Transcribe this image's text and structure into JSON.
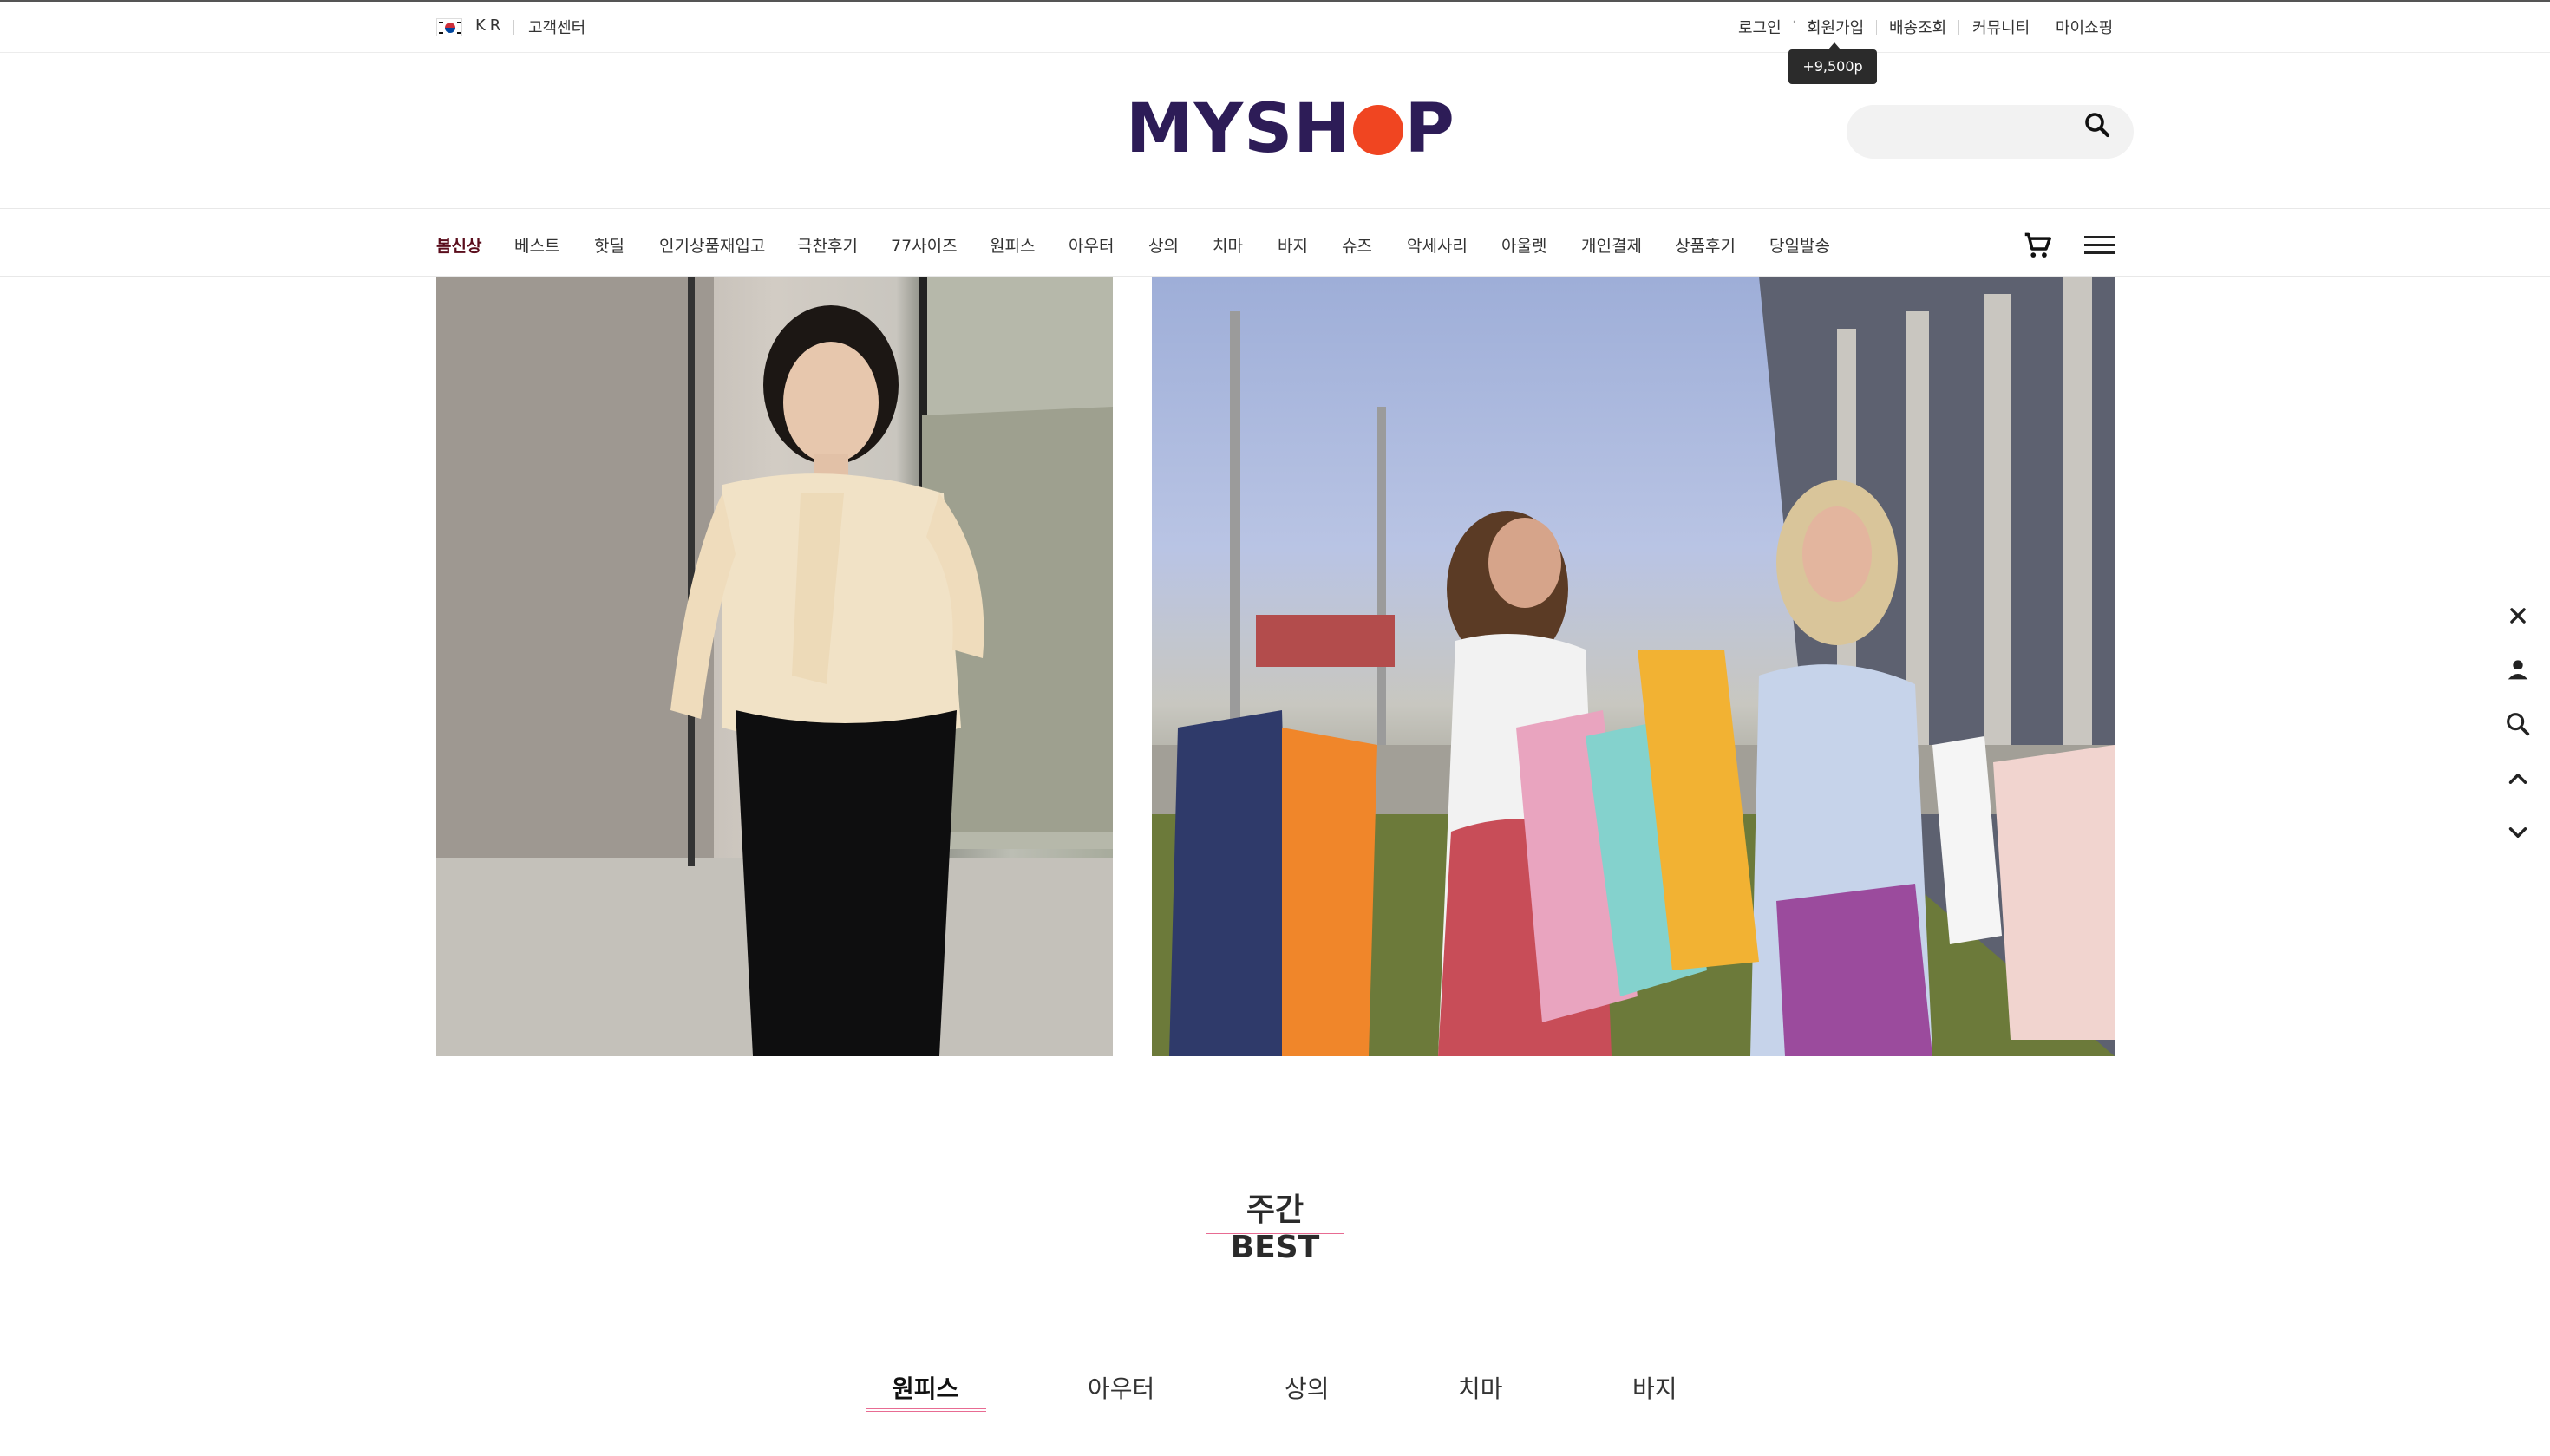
{
  "topbar": {
    "country": "KR",
    "cs_center": "고객센터",
    "links": [
      "로그인",
      "회원가입",
      "배송조회",
      "커뮤니티",
      "마이쇼핑"
    ],
    "tooltip": "+9,500p"
  },
  "header": {
    "logo_left": "MYSH",
    "logo_right": "P",
    "search": {
      "placeholder": "",
      "value": ""
    }
  },
  "gnb": {
    "items": [
      "봄신상",
      "베스트",
      "핫딜",
      "인기상품재입고",
      "극찬후기",
      "77사이즈",
      "원피스",
      "아우터",
      "상의",
      "치마",
      "바지",
      "슈즈",
      "악세사리",
      "아울렛",
      "개인결제",
      "상품후기",
      "당일발송"
    ],
    "active_index": 0
  },
  "banner": {
    "slides": 3,
    "active_slide": 1
  },
  "quick_menu": [
    "close-icon",
    "user-icon",
    "search-icon",
    "arrow-up-icon",
    "arrow-down-icon"
  ],
  "weekly_best": {
    "title": "주간 BEST",
    "tabs": [
      "원피스",
      "아우터",
      "상의",
      "치마",
      "바지"
    ],
    "active_tab": 0
  },
  "colors": {
    "logo": "#2d1c57",
    "logo_accent": "#f04521",
    "active_nav": "#5a0d1c",
    "underline": "#e86b92"
  }
}
